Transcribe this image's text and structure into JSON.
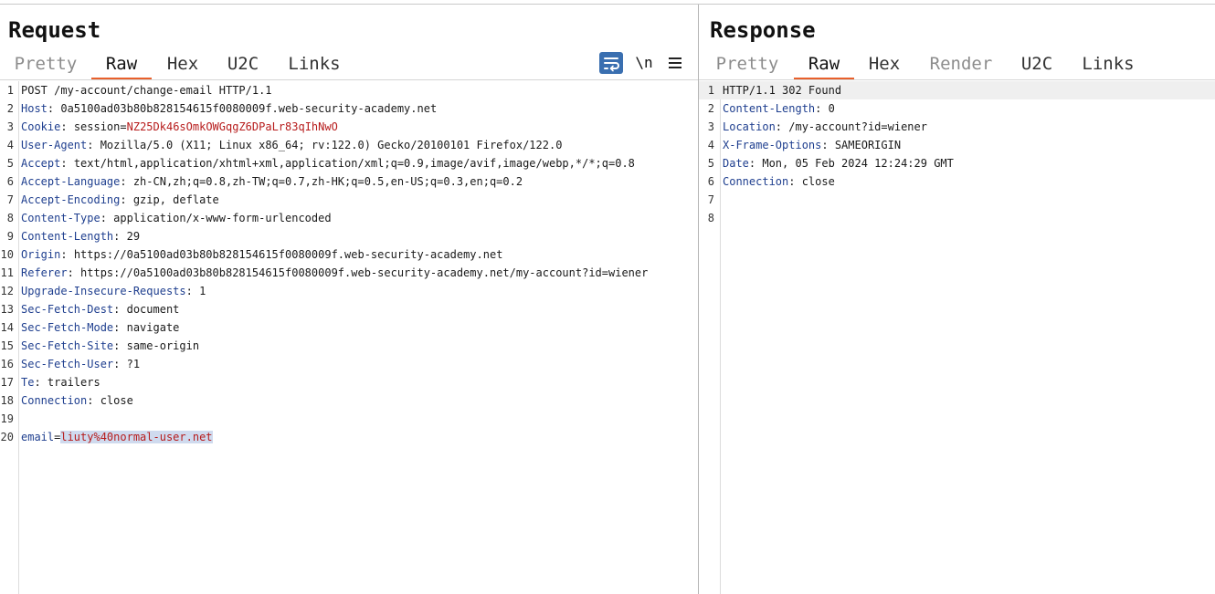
{
  "request": {
    "title": "Request",
    "tabs": [
      {
        "label": "Pretty",
        "state": "muted"
      },
      {
        "label": "Raw",
        "state": "active"
      },
      {
        "label": "Hex",
        "state": "normal"
      },
      {
        "label": "U2C",
        "state": "normal"
      },
      {
        "label": "Links",
        "state": "normal"
      }
    ],
    "toolbar": {
      "wrap_icon": "word-wrap-icon",
      "newline_label": "\\n",
      "menu_icon": "hamburger-menu-icon",
      "accent": "#3a6fb0"
    },
    "lines": [
      {
        "n": "1",
        "text": "POST /my-account/change-email HTTP/1.1"
      },
      {
        "n": "2",
        "key": "Host",
        "val": "0a5100ad03b80b828154615f0080009f.web-security-academy.net"
      },
      {
        "n": "3",
        "key": "Cookie",
        "cookie_name": "session",
        "cookie_val": "NZ25Dk46sOmkOWGqgZ6DPaLr83qIhNwO"
      },
      {
        "n": "4",
        "key": "User-Agent",
        "val": "Mozilla/5.0 (X11; Linux x86_64; rv:122.0) Gecko/20100101 Firefox/122.0"
      },
      {
        "n": "5",
        "key": "Accept",
        "val": "text/html,application/xhtml+xml,application/xml;q=0.9,image/avif,image/webp,*/*;q=0.8"
      },
      {
        "n": "6",
        "key": "Accept-Language",
        "val": "zh-CN,zh;q=0.8,zh-TW;q=0.7,zh-HK;q=0.5,en-US;q=0.3,en;q=0.2"
      },
      {
        "n": "7",
        "key": "Accept-Encoding",
        "val": "gzip, deflate"
      },
      {
        "n": "8",
        "key": "Content-Type",
        "val": "application/x-www-form-urlencoded"
      },
      {
        "n": "9",
        "key": "Content-Length",
        "val": "29"
      },
      {
        "n": "10",
        "key": "Origin",
        "val": "https://0a5100ad03b80b828154615f0080009f.web-security-academy.net"
      },
      {
        "n": "11",
        "key": "Referer",
        "val": "https://0a5100ad03b80b828154615f0080009f.web-security-academy.net/my-account?id=wiener"
      },
      {
        "n": "12",
        "key": "Upgrade-Insecure-Requests",
        "val": "1"
      },
      {
        "n": "13",
        "key": "Sec-Fetch-Dest",
        "val": "document"
      },
      {
        "n": "14",
        "key": "Sec-Fetch-Mode",
        "val": "navigate"
      },
      {
        "n": "15",
        "key": "Sec-Fetch-Site",
        "val": "same-origin"
      },
      {
        "n": "16",
        "key": "Sec-Fetch-User",
        "val": "?1"
      },
      {
        "n": "17",
        "key": "Te",
        "val": "trailers"
      },
      {
        "n": "18",
        "key": "Connection",
        "val": "close"
      },
      {
        "n": "19",
        "text": ""
      },
      {
        "n": "20",
        "param": "email",
        "param_val": "liuty%40normal-user.net",
        "selected": true
      }
    ]
  },
  "response": {
    "title": "Response",
    "tabs": [
      {
        "label": "Pretty",
        "state": "muted"
      },
      {
        "label": "Raw",
        "state": "active"
      },
      {
        "label": "Hex",
        "state": "normal"
      },
      {
        "label": "Render",
        "state": "muted"
      },
      {
        "label": "U2C",
        "state": "normal"
      },
      {
        "label": "Links",
        "state": "normal"
      }
    ],
    "lines": [
      {
        "n": "1",
        "text": "HTTP/1.1 302 Found",
        "highlight": true
      },
      {
        "n": "2",
        "key": "Content-Length",
        "val": "0"
      },
      {
        "n": "3",
        "key": "Location",
        "val": "/my-account?id=wiener"
      },
      {
        "n": "4",
        "key": "X-Frame-Options",
        "val": "SAMEORIGIN"
      },
      {
        "n": "5",
        "key": "Date",
        "val": "Mon, 05 Feb 2024 12:24:29 GMT"
      },
      {
        "n": "6",
        "key": "Connection",
        "val": "close"
      },
      {
        "n": "7",
        "text": ""
      },
      {
        "n": "8",
        "text": ""
      }
    ]
  }
}
